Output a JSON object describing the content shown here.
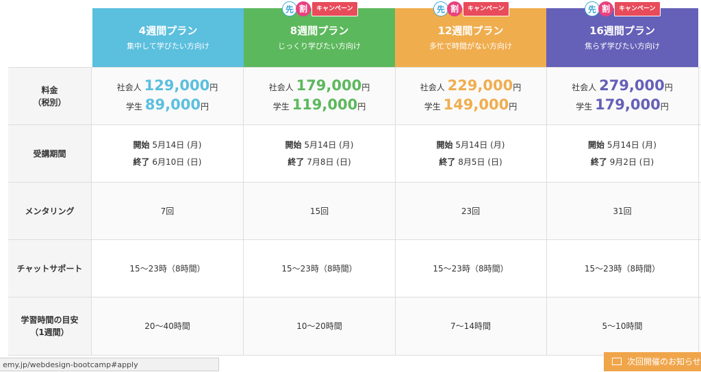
{
  "plans": [
    {
      "name": "4週間プラン",
      "tagline": "集中して学びたい方向け",
      "color": "#5bbfde",
      "campaign": false
    },
    {
      "name": "8週間プラン",
      "tagline": "じっくり学びたい方向け",
      "color": "#5cb85c",
      "campaign": true
    },
    {
      "name": "12週間プラン",
      "tagline": "多忙で時間がない方向け",
      "color": "#f0ad4e",
      "campaign": true
    },
    {
      "name": "16週間プラン",
      "tagline": "焦らず学びたい方向け",
      "color": "#6560b8",
      "campaign": true
    }
  ],
  "badge": {
    "saki": "先",
    "wari": "割",
    "campaign": "キャンペーン"
  },
  "rows": {
    "fee": {
      "label_line1": "料金",
      "label_line2": "（税別）"
    },
    "period": {
      "label": "受講期間"
    },
    "mentoring": {
      "label": "メンタリング"
    },
    "chat": {
      "label": "チャットサポート"
    },
    "study": {
      "label_line1": "学習時間の目安",
      "label_line2": "（1週間）"
    }
  },
  "fees": [
    {
      "worker_label": "社会人",
      "worker_price": "129,000",
      "student_label": "学生",
      "student_price": "89,000",
      "yen": "円"
    },
    {
      "worker_label": "社会人",
      "worker_price": "179,000",
      "student_label": "学生",
      "student_price": "119,000",
      "yen": "円"
    },
    {
      "worker_label": "社会人",
      "worker_price": "229,000",
      "student_label": "学生",
      "student_price": "149,000",
      "yen": "円"
    },
    {
      "worker_label": "社会人",
      "worker_price": "279,000",
      "student_label": "学生",
      "student_price": "179,000",
      "yen": "円"
    }
  ],
  "periods": [
    {
      "start_label": "開始",
      "start": "5月14日 (月)",
      "end_label": "終了",
      "end": "6月10日 (日)"
    },
    {
      "start_label": "開始",
      "start": "5月14日 (月)",
      "end_label": "終了",
      "end": "7月8日 (日)"
    },
    {
      "start_label": "開始",
      "start": "5月14日 (月)",
      "end_label": "終了",
      "end": "8月5日 (日)"
    },
    {
      "start_label": "開始",
      "start": "5月14日 (月)",
      "end_label": "終了",
      "end": "9月2日 (日)"
    }
  ],
  "mentoring": [
    "7回",
    "15回",
    "23回",
    "31回"
  ],
  "chat": [
    "15〜23時（8時間）",
    "15〜23時（8時間）",
    "15〜23時（8時間）",
    "15〜23時（8時間）"
  ],
  "study": [
    "20〜40時間",
    "10〜20時間",
    "7〜14時間",
    "5〜10時間"
  ],
  "status_url": "emy.jp/webdesign-bootcamp#apply",
  "notice": {
    "label": "次回開催のお知らせ",
    "icon": "mail-icon"
  }
}
